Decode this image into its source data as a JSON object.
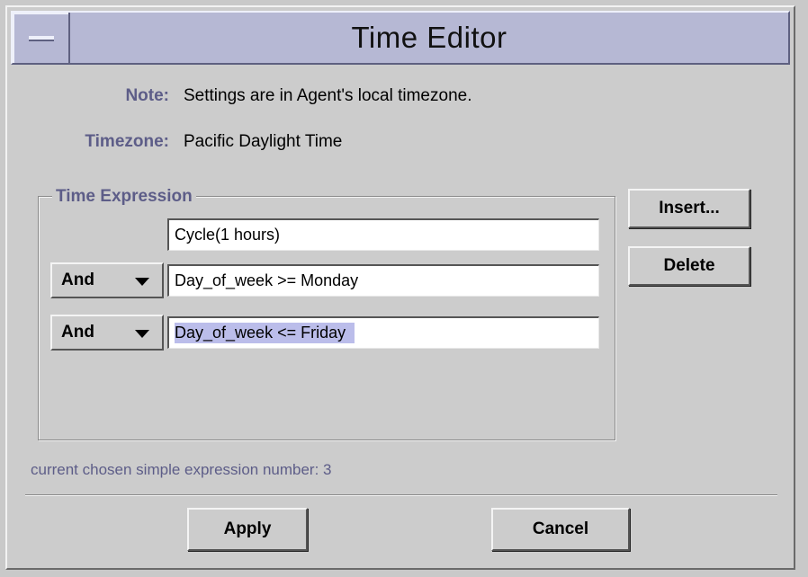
{
  "window": {
    "title": "Time Editor"
  },
  "info": {
    "note_label": "Note:",
    "note_value": "Settings are in Agent's local timezone.",
    "timezone_label": "Timezone:",
    "timezone_value": "Pacific Daylight Time"
  },
  "expression": {
    "legend": "Time Expression",
    "rows": [
      {
        "operator": null,
        "value": "Cycle(1 hours)"
      },
      {
        "operator": "And",
        "value": "Day_of_week >= Monday"
      },
      {
        "operator": "And",
        "value": "Day_of_week <= Friday",
        "selected": true
      }
    ]
  },
  "actions": {
    "insert_label": "Insert...",
    "delete_label": "Delete"
  },
  "status": "current chosen simple expression number: 3",
  "footer": {
    "apply_label": "Apply",
    "cancel_label": "Cancel"
  },
  "colors": {
    "title_bar": "#b6b8d4",
    "label_text": "#5d5d88",
    "selection": "#bbbdea",
    "background": "#cccccc"
  },
  "icons": {
    "window_menu": "window-menu-icon",
    "dropdown": "chevron-down-icon"
  }
}
